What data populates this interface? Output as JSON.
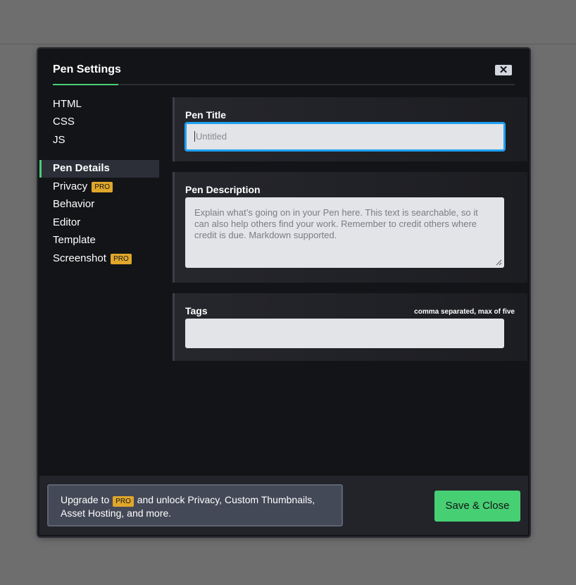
{
  "modal": {
    "title": "Pen Settings",
    "close_label": "✕"
  },
  "nav": {
    "items": [
      {
        "label": "HTML",
        "pro": false
      },
      {
        "label": "CSS",
        "pro": false
      },
      {
        "label": "JS",
        "pro": false
      },
      {
        "label": "Pen Details",
        "pro": false,
        "active": true
      },
      {
        "label": "Privacy",
        "pro": true
      },
      {
        "label": "Behavior",
        "pro": false
      },
      {
        "label": "Editor",
        "pro": false
      },
      {
        "label": "Template",
        "pro": false
      },
      {
        "label": "Screenshot",
        "pro": true
      }
    ],
    "pro_badge": "PRO"
  },
  "pen_title": {
    "label": "Pen Title",
    "placeholder": "Untitled",
    "value": ""
  },
  "pen_description": {
    "label": "Pen Description",
    "placeholder": "Explain what’s going on in your Pen here. This text is searchable, so it can also help others find your work. Remember to credit others where credit is due. Markdown supported.",
    "value": ""
  },
  "tags": {
    "label": "Tags",
    "hint": "comma separated, max of five",
    "value": ""
  },
  "footer": {
    "upgrade_prefix": "Upgrade to",
    "upgrade_badge": "PRO",
    "upgrade_suffix": "and unlock Privacy, Custom Thumbnails, Asset Hosting, and more.",
    "save_label": "Save & Close"
  },
  "colors": {
    "accent": "#47cf73",
    "pro_badge": "#e0a72b",
    "focus_border": "#1fa1f2",
    "modal_bg": "#131417",
    "overlay_bg": "#6e6e6e"
  }
}
